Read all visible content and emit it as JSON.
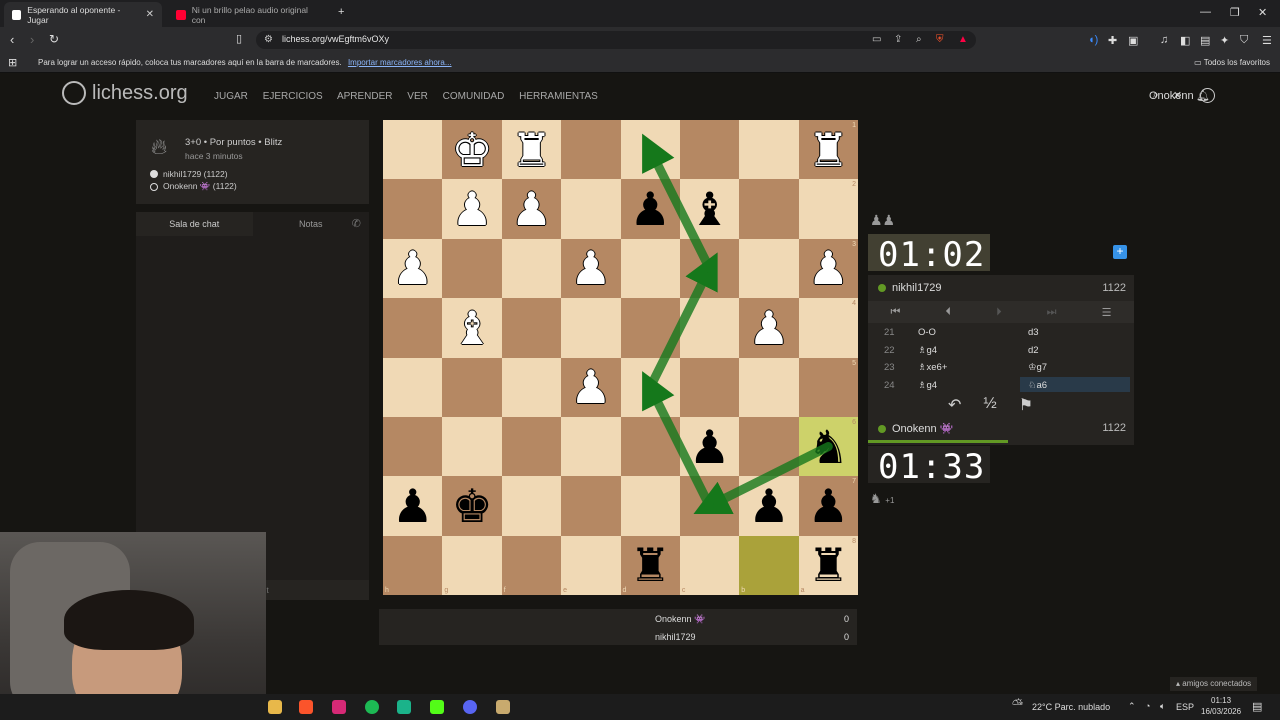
{
  "browser": {
    "tabs": [
      {
        "title": "Esperando al oponente - Jugar",
        "active": true
      },
      {
        "title": "Ni un brillo pelao audio original con",
        "active": false
      }
    ],
    "url": "lichess.org/vwEgftm6vOXy",
    "bookmarks_hint": "Para lograr un acceso rápido, coloca tus marcadores aquí en la barra de marcadores.",
    "bookmarks_link": "Importar marcadores ahora...",
    "bookmarks_all": "Todos los favoritos"
  },
  "site": {
    "logo": "lichess.org",
    "nav": [
      "JUGAR",
      "EJERCICIOS",
      "APRENDER",
      "VER",
      "COMUNIDAD",
      "HERRAMIENTAS"
    ],
    "username": "Onokenn"
  },
  "game_info": {
    "mode": "3+0 • Por puntos • Blitz",
    "time_ago": "hace 3 minutos",
    "players": [
      {
        "name": "nikhil1729 (1122)",
        "color": "white"
      },
      {
        "name": "Onokenn 👾 (1122)",
        "color": "black"
      }
    ]
  },
  "chat": {
    "tabs": [
      "Sala de chat",
      "Notas"
    ],
    "input_hint": "nt"
  },
  "board": {
    "flipped": true,
    "ranks_labels": [
      "1",
      "2",
      "3",
      "4",
      "5",
      "6",
      "7",
      "8"
    ],
    "files_labels": [
      "h",
      "g",
      "f",
      "e",
      "d",
      "c",
      "b",
      "a"
    ],
    "pieces": [
      {
        "sq": "g1",
        "glyph": "♚",
        "color": "w"
      },
      {
        "sq": "f1",
        "glyph": "♜",
        "color": "w"
      },
      {
        "sq": "a1",
        "glyph": "♜",
        "color": "w"
      },
      {
        "sq": "g2",
        "glyph": "♟",
        "color": "w"
      },
      {
        "sq": "f2",
        "glyph": "♟",
        "color": "w"
      },
      {
        "sq": "d2",
        "glyph": "♟",
        "color": "b"
      },
      {
        "sq": "c2",
        "glyph": "♝",
        "color": "b"
      },
      {
        "sq": "h3",
        "glyph": "♟",
        "color": "w"
      },
      {
        "sq": "e3",
        "glyph": "♟",
        "color": "w"
      },
      {
        "sq": "a3",
        "glyph": "♟",
        "color": "w"
      },
      {
        "sq": "g4",
        "glyph": "♝",
        "color": "w"
      },
      {
        "sq": "b4",
        "glyph": "♟",
        "color": "w"
      },
      {
        "sq": "e5",
        "glyph": "♟",
        "color": "w"
      },
      {
        "sq": "c6",
        "glyph": "♟",
        "color": "b"
      },
      {
        "sq": "a6",
        "glyph": "♞",
        "color": "b"
      },
      {
        "sq": "h7",
        "glyph": "♟",
        "color": "b"
      },
      {
        "sq": "g7",
        "glyph": "♚",
        "color": "b"
      },
      {
        "sq": "b7",
        "glyph": "♟",
        "color": "b"
      },
      {
        "sq": "a7",
        "glyph": "♟",
        "color": "b"
      },
      {
        "sq": "d8",
        "glyph": "♜",
        "color": "b"
      },
      {
        "sq": "a8",
        "glyph": "♜",
        "color": "b"
      }
    ],
    "last_move": [
      "b8",
      "a6"
    ],
    "arrows": [
      [
        "a6",
        "c7"
      ],
      [
        "c7",
        "d5"
      ],
      [
        "d5",
        "c3"
      ],
      [
        "c3",
        "d1"
      ]
    ]
  },
  "clocks": {
    "top": {
      "time": "01:02",
      "player": "nikhil1729",
      "rating": "1122"
    },
    "bottom": {
      "time": "01:33",
      "player": "Onokenn 👾",
      "rating": "1122"
    }
  },
  "captured_bottom": "+1",
  "moves": [
    {
      "n": "21",
      "w": "O-O",
      "b": "d3"
    },
    {
      "n": "22",
      "w": "♗g4",
      "b": "d2"
    },
    {
      "n": "23",
      "w": "♗xe6+",
      "b": "♔g7"
    },
    {
      "n": "24",
      "w": "♗g4",
      "b": "♘a6"
    }
  ],
  "move_controls": [
    "⏮",
    "⏴",
    "⏵",
    "⏭",
    "☰"
  ],
  "actions": [
    "↶",
    "½",
    "⚑"
  ],
  "scoreboard": [
    {
      "name": "Onokenn 👾",
      "score": "0"
    },
    {
      "name": "nikhil1729",
      "score": "0"
    }
  ],
  "friends_online": "amigos conectados",
  "taskbar": {
    "weather": "22°C  Parc. nublado",
    "lang": "ESP",
    "time": "01:13",
    "date": "16/03/2026"
  },
  "colors": {
    "light_square": "#f0d9b5",
    "dark_square": "#b58863",
    "arrow": "#15781b",
    "accent_green": "#629924"
  }
}
